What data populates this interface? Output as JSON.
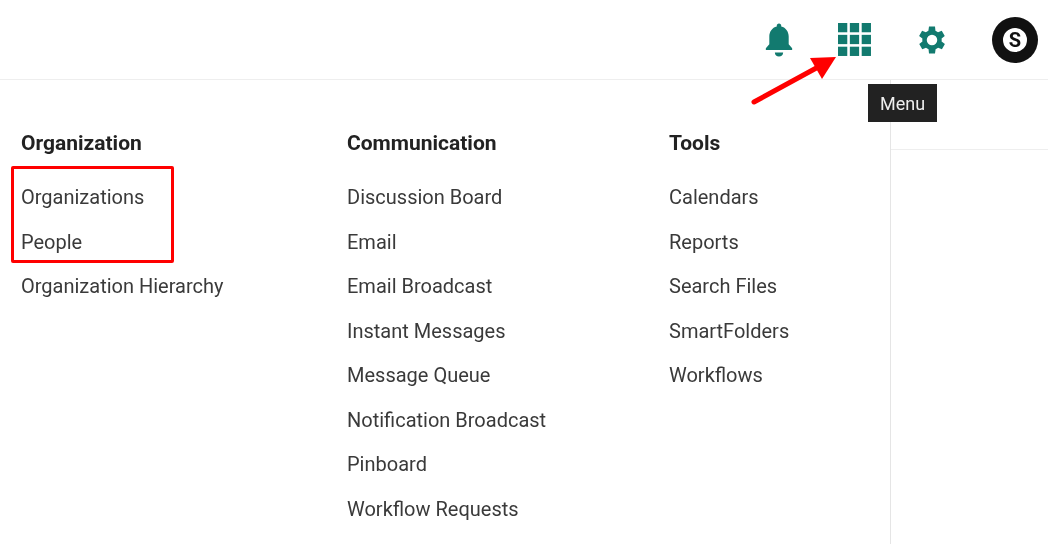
{
  "top_bar": {
    "avatar": {
      "letter": "S"
    },
    "tooltip": "Menu"
  },
  "menu": {
    "columns": [
      {
        "heading": "Organization",
        "items": [
          "Organizations",
          "People",
          "Organization Hierarchy"
        ]
      },
      {
        "heading": "Communication",
        "items": [
          "Discussion Board",
          "Email",
          "Email Broadcast",
          "Instant Messages",
          "Message Queue",
          "Notification Broadcast",
          "Pinboard",
          "Workflow Requests"
        ]
      },
      {
        "heading": "Tools",
        "items": [
          "Calendars",
          "Reports",
          "Search Files",
          "SmartFolders",
          "Workflows"
        ]
      }
    ]
  }
}
